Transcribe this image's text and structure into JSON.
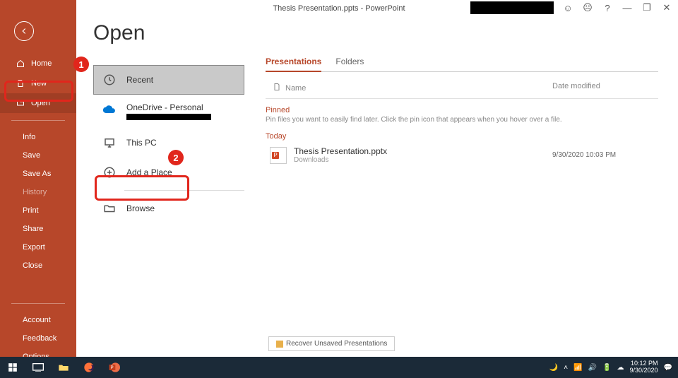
{
  "title": "Thesis Presentation.ppts  -  PowerPoint",
  "titlebar_icons": {
    "face1": "☺",
    "face2": "☹",
    "help": "?",
    "min": "—",
    "max": "❐",
    "close": "✕"
  },
  "sidebar": {
    "home": "Home",
    "new": "New",
    "open": "Open",
    "info": "Info",
    "save": "Save",
    "saveas": "Save As",
    "history": "History",
    "print": "Print",
    "share": "Share",
    "export": "Export",
    "close": "Close",
    "account": "Account",
    "feedback": "Feedback",
    "options": "Options"
  },
  "heading": "Open",
  "locations": {
    "recent": "Recent",
    "onedrive": "OneDrive - Personal",
    "thispc": "This PC",
    "addplace": "Add a Place",
    "browse": "Browse"
  },
  "tabs": {
    "presentations": "Presentations",
    "folders": "Folders"
  },
  "list_header": {
    "name": "Name",
    "date": "Date modified"
  },
  "pinned": {
    "label": "Pinned",
    "hint": "Pin files you want to easily find later. Click the pin icon that appears when you hover over a file."
  },
  "today": {
    "label": "Today"
  },
  "file": {
    "name": "Thesis Presentation.pptx",
    "sub": "Downloads",
    "date": "9/30/2020 10:03 PM"
  },
  "recover": "Recover Unsaved Presentations",
  "annotations": {
    "one": "1",
    "two": "2"
  },
  "taskbar": {
    "time": "10:12 PM",
    "date": "9/30/2020"
  }
}
